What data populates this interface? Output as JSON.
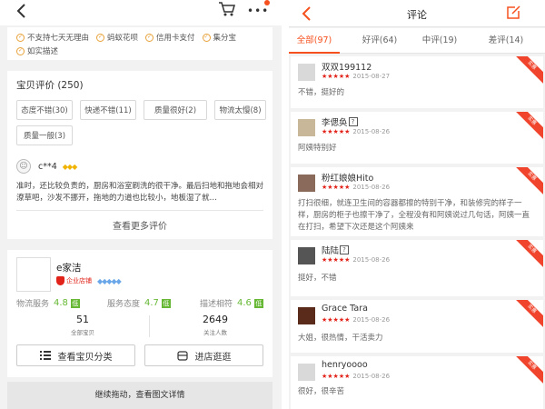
{
  "left": {
    "services": [
      "不支持七天无理由",
      "蚂蚁花呗",
      "信用卡支付",
      "集分宝",
      "如实描述"
    ],
    "reviews": {
      "title": "宝贝评价 (250)",
      "tags": [
        "态度不错(30)",
        "快递不错(11)",
        "质量很好(2)",
        "物流太慢(8)",
        "质量一般(3)"
      ],
      "user": "c**4",
      "text": "准时，还比较负责的，厨房和浴室刷洗的很干净。最后扫地和拖地会相对潦草吧，沙发不挪开，拖地的力道也比较小，地板湿了就…",
      "more": "查看更多评价"
    },
    "shop": {
      "name": "e家洁",
      "enterprise": "企业店铺",
      "scores": [
        {
          "label": "物流服务",
          "value": "4.8",
          "level": "低"
        },
        {
          "label": "服务态度",
          "value": "4.7",
          "level": "低"
        },
        {
          "label": "描述相符",
          "value": "4.6",
          "level": "低"
        }
      ],
      "stats": [
        {
          "value": "51",
          "label": "全部宝贝"
        },
        {
          "value": "2649",
          "label": "关注人数"
        }
      ],
      "btn_category": "查看宝贝分类",
      "btn_enter": "进店逛逛"
    },
    "continue": "继续拖动，查看图文详情"
  },
  "right": {
    "title": "评论",
    "tabs": [
      {
        "label": "全部(97)",
        "active": true
      },
      {
        "label": "好评(64)",
        "active": false
      },
      {
        "label": "中评(19)",
        "active": false
      },
      {
        "label": "差评(14)",
        "active": false
      }
    ],
    "badge": "实惠",
    "comments": [
      {
        "name": "双双199112",
        "date": "2015-08-27",
        "text": "不错，挺好的",
        "q": false
      },
      {
        "name": "李偲奂",
        "date": "2015-08-26",
        "text": "阿姨特别好",
        "q": true
      },
      {
        "name": "粉红娘娘Hito",
        "date": "2015-08-26",
        "text": "打扫很细，就连卫生间的容器都擦的特别干净，和装修完的样子一样，厨房的柜子也擦干净了，全程没有和阿姨说过几句话，阿姨一直在打扫，希望下次还是这个阿姨来",
        "q": false
      },
      {
        "name": "陆陆",
        "date": "2015-08-26",
        "text": "挺好，不错",
        "q": true
      },
      {
        "name": "Grace Tara",
        "date": "2015-08-26",
        "text": "大姐，很热情，干活卖力",
        "q": false
      },
      {
        "name": "henryoooo",
        "date": "2015-08-26",
        "text": "很好，很辛苦",
        "q": false
      }
    ]
  }
}
